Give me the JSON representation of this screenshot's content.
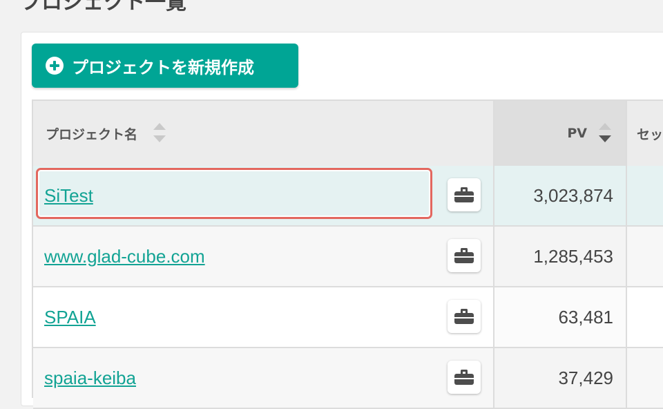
{
  "page": {
    "title": "プロジェクト一覧"
  },
  "toolbar": {
    "create_label": "プロジェクトを新規作成"
  },
  "table": {
    "columns": {
      "name": "プロジェクト名",
      "pv": "PV",
      "sessions": "セッ"
    },
    "rows": [
      {
        "name": "SiTest",
        "pv": "3,023,874",
        "selected": true
      },
      {
        "name": "www.glad-cube.com",
        "pv": "1,285,453"
      },
      {
        "name": "SPAIA",
        "pv": "63,481"
      },
      {
        "name": "spaia-keiba",
        "pv": "37,429"
      }
    ]
  },
  "colors": {
    "accent": "#00a595",
    "link": "#12a394",
    "highlight": "#e3675f"
  },
  "icons": {
    "create": "plus-circle-icon",
    "tool": "briefcase-icon",
    "sort": "sort-icon"
  }
}
